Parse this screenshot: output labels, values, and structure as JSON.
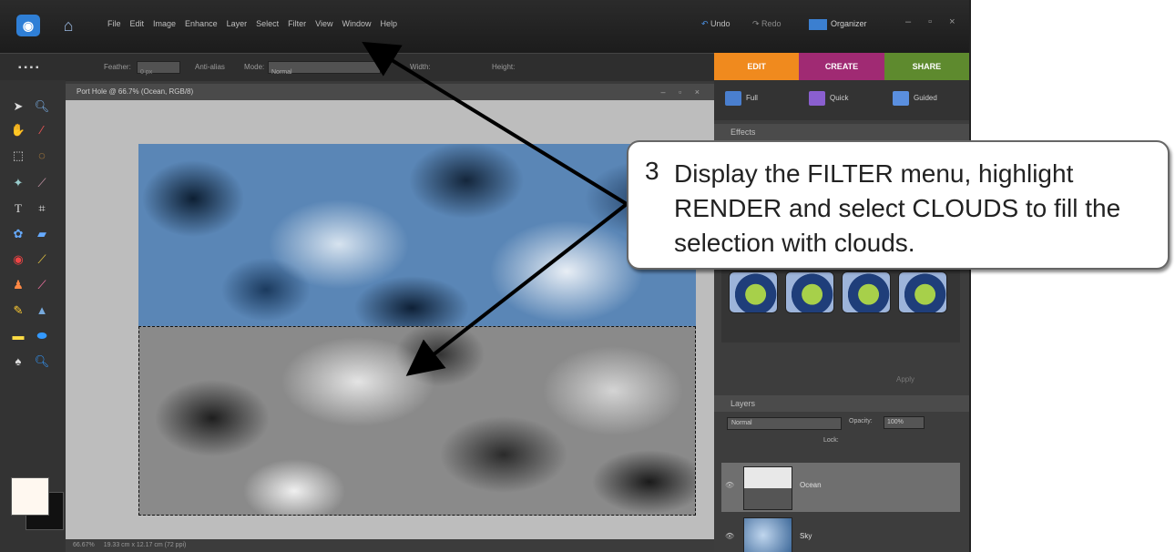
{
  "app": {
    "menu": [
      "File",
      "Edit",
      "Image",
      "Enhance",
      "Layer",
      "Select",
      "Filter",
      "View",
      "Window",
      "Help"
    ],
    "undo_label": "Undo",
    "redo_label": "Redo",
    "organizer_label": "Organizer",
    "tabs": [
      "EDIT",
      "CREATE",
      "SHARE"
    ],
    "options": {
      "feather_label": "Feather:",
      "feather_value": "0 px",
      "antialias_label": "Anti-alias",
      "mode_label": "Mode:",
      "mode_value": "Normal",
      "width_label": "Width:",
      "height_label": "Height:"
    },
    "document_title": "Port Hole @ 66.7% (Ocean, RGB/8)",
    "status_zoom": "66.67%",
    "status_size": "19.33 cm x 12.17 cm (72 ppi)",
    "panel_modes": [
      "Full",
      "Quick",
      "Guided"
    ],
    "effects_header": "Effects",
    "apply_label": "Apply",
    "layers_header": "Layers",
    "blend_mode": "Normal",
    "opacity_label": "Opacity:",
    "opacity_value": "100%",
    "lock_label": "Lock:",
    "layers": [
      {
        "name": "Ocean",
        "selected": true
      },
      {
        "name": "Sky",
        "selected": false
      }
    ]
  },
  "callout": {
    "step": "3",
    "text": "Display the FILTER menu, highlight RENDER and select CLOUDS to fill the selection with clouds."
  },
  "colors": {
    "edit_tab": "#f08a1e",
    "create_tab": "#a02a73",
    "share_tab": "#5e8a2e",
    "foreground": "#fff8f0",
    "background": "#111111"
  }
}
